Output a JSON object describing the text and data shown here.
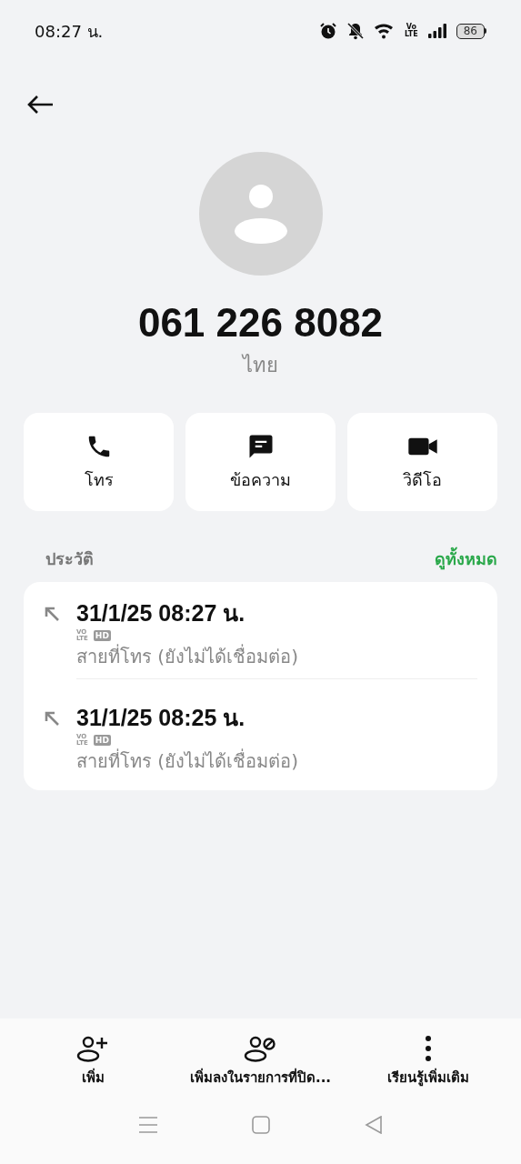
{
  "status_bar": {
    "time": "08:27 น.",
    "network_badge": "Vo LTE",
    "battery": "86"
  },
  "contact": {
    "number": "061 226 8082",
    "location": "ไทย"
  },
  "actions": [
    {
      "kind": "call",
      "label": "โทร"
    },
    {
      "kind": "message",
      "label": "ข้อความ"
    },
    {
      "kind": "video",
      "label": "วิดีโอ"
    }
  ],
  "history": {
    "title": "ประวัติ",
    "see_all": "ดูทั้งหมด",
    "calls": [
      {
        "time": "31/1/25 08:27 น.",
        "badges": [
          "VO LTE",
          "HD"
        ],
        "status": "สายที่โทร (ยังไม่ได้เชื่อมต่อ)"
      },
      {
        "time": "31/1/25 08:25 น.",
        "badges": [
          "VO LTE",
          "HD"
        ],
        "status": "สายที่โทร (ยังไม่ได้เชื่อมต่อ)"
      }
    ]
  },
  "bottom_actions": [
    {
      "kind": "add",
      "label": "เพิ่ม"
    },
    {
      "kind": "block",
      "label": "เพิ่มลงในรายการที่ปิด..."
    },
    {
      "kind": "more",
      "label": "เรียนรู้เพิ่มเติม"
    }
  ]
}
